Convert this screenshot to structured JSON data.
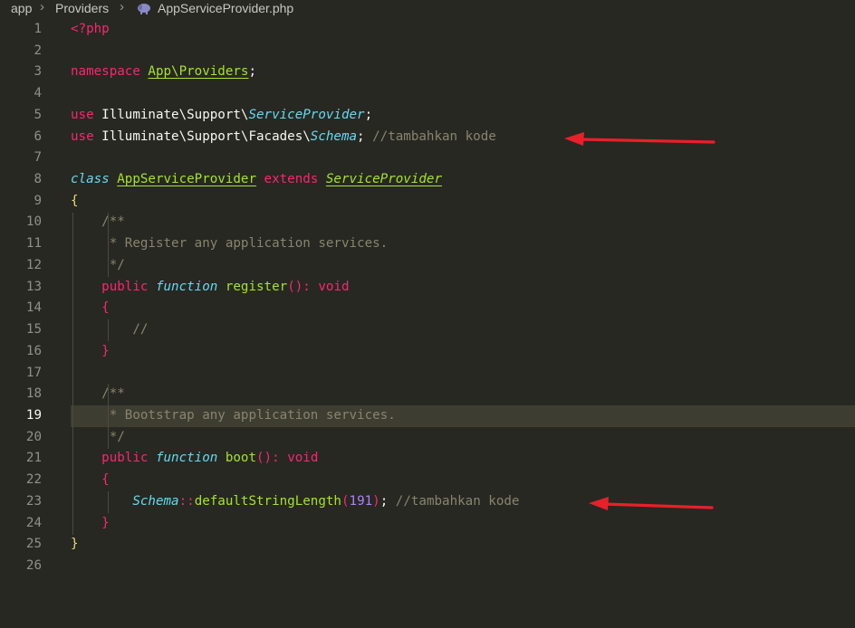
{
  "breadcrumb": {
    "segment_app": "app",
    "segment_providers": "Providers",
    "file_name": "AppServiceProvider.php",
    "file_icon": "php-elephant-icon"
  },
  "editor": {
    "active_line": 19,
    "lines": [
      {
        "n": "1",
        "tokens": [
          {
            "t": "<?php",
            "c": "kw"
          }
        ]
      },
      {
        "n": "2",
        "tokens": []
      },
      {
        "n": "3",
        "tokens": [
          {
            "t": "namespace ",
            "c": "kw"
          },
          {
            "t": "App\\Providers",
            "c": "fnu"
          },
          {
            "t": ";",
            "c": ""
          }
        ]
      },
      {
        "n": "4",
        "tokens": []
      },
      {
        "n": "5",
        "tokens": [
          {
            "t": "use ",
            "c": "kw"
          },
          {
            "t": "Illuminate\\Support\\",
            "c": ""
          },
          {
            "t": "ServiceProvider",
            "c": "ty"
          },
          {
            "t": ";",
            "c": ""
          }
        ]
      },
      {
        "n": "6",
        "tokens": [
          {
            "t": "use ",
            "c": "kw"
          },
          {
            "t": "Illuminate\\Support\\Facades\\",
            "c": ""
          },
          {
            "t": "Schema",
            "c": "ty"
          },
          {
            "t": "; ",
            "c": ""
          },
          {
            "t": "//tambahkan kode",
            "c": "cm"
          }
        ]
      },
      {
        "n": "7",
        "tokens": []
      },
      {
        "n": "8",
        "tokens": [
          {
            "t": "class ",
            "c": "ty"
          },
          {
            "t": "AppServiceProvider",
            "c": "fnu"
          },
          {
            "t": " extends ",
            "c": "kw"
          },
          {
            "t": "ServiceProvider",
            "c": "fnu ity"
          }
        ]
      },
      {
        "n": "9",
        "tokens": [
          {
            "t": "{",
            "c": "brk"
          }
        ]
      },
      {
        "n": "10",
        "tokens": [
          {
            "t": "    /**",
            "c": "cm"
          }
        ]
      },
      {
        "n": "11",
        "tokens": [
          {
            "t": "     * Register any application services.",
            "c": "cm"
          }
        ]
      },
      {
        "n": "12",
        "tokens": [
          {
            "t": "     */",
            "c": "cm"
          }
        ]
      },
      {
        "n": "13",
        "tokens": [
          {
            "t": "    public ",
            "c": "kw"
          },
          {
            "t": "function ",
            "c": "ty"
          },
          {
            "t": "register",
            "c": "fn"
          },
          {
            "t": "()",
            "c": "kw"
          },
          {
            "t": ": ",
            "c": "kw"
          },
          {
            "t": "void",
            "c": "kw"
          }
        ]
      },
      {
        "n": "14",
        "tokens": [
          {
            "t": "    {",
            "c": "kw"
          }
        ]
      },
      {
        "n": "15",
        "tokens": [
          {
            "t": "        //",
            "c": "cm"
          }
        ]
      },
      {
        "n": "16",
        "tokens": [
          {
            "t": "    }",
            "c": "kw"
          }
        ]
      },
      {
        "n": "17",
        "tokens": []
      },
      {
        "n": "18",
        "tokens": [
          {
            "t": "    /**",
            "c": "cm"
          }
        ]
      },
      {
        "n": "19",
        "tokens": [
          {
            "t": "     * Bootstrap any application services.",
            "c": "cm"
          }
        ]
      },
      {
        "n": "20",
        "tokens": [
          {
            "t": "     */",
            "c": "cm"
          }
        ]
      },
      {
        "n": "21",
        "tokens": [
          {
            "t": "    public ",
            "c": "kw"
          },
          {
            "t": "function ",
            "c": "ty"
          },
          {
            "t": "boot",
            "c": "fn"
          },
          {
            "t": "()",
            "c": "kw"
          },
          {
            "t": ": ",
            "c": "kw"
          },
          {
            "t": "void",
            "c": "kw"
          }
        ]
      },
      {
        "n": "22",
        "tokens": [
          {
            "t": "    {",
            "c": "kw"
          }
        ]
      },
      {
        "n": "23",
        "tokens": [
          {
            "t": "        ",
            "c": ""
          },
          {
            "t": "Schema",
            "c": "ty"
          },
          {
            "t": "::",
            "c": "kw"
          },
          {
            "t": "defaultStringLength",
            "c": "fn"
          },
          {
            "t": "(",
            "c": "kw"
          },
          {
            "t": "191",
            "c": "num"
          },
          {
            "t": ")",
            "c": "kw"
          },
          {
            "t": "; ",
            "c": ""
          },
          {
            "t": "//tambahkan kode",
            "c": "cm"
          }
        ]
      },
      {
        "n": "24",
        "tokens": [
          {
            "t": "    }",
            "c": "kw"
          }
        ]
      },
      {
        "n": "25",
        "tokens": [
          {
            "t": "}",
            "c": "brk"
          }
        ]
      },
      {
        "n": "26",
        "tokens": []
      }
    ]
  },
  "annotations": {
    "arrow_color": "#e8202a",
    "arrows": [
      {
        "points_at_line": 6,
        "icon": "red-arrow-icon"
      },
      {
        "points_at_line": 23,
        "icon": "red-arrow-icon"
      }
    ]
  },
  "colors": {
    "background": "#272822",
    "active_line": "#3e3d32",
    "keyword": "#f92672",
    "function": "#a6e22e",
    "type": "#66d9ef",
    "comment": "#88846f",
    "number": "#ae81ff"
  }
}
